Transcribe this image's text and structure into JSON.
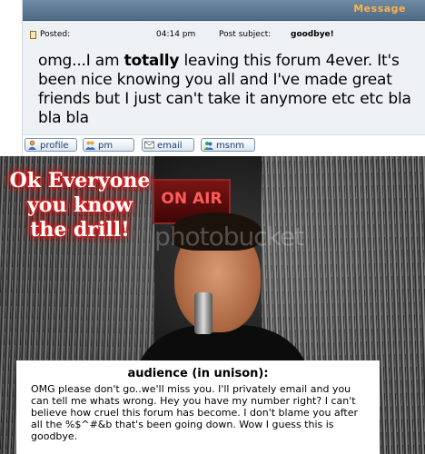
{
  "header": {
    "title": "Message"
  },
  "post": {
    "posted_label": "Posted:",
    "time": "04:14 pm",
    "subject_label": "Post subject:",
    "subject": "goodbye!",
    "body_before": "omg...I am ",
    "body_bold": "totally",
    "body_after": " leaving this forum 4ever. It's been nice knowing you all and I've made great friends but I just can't take it anymore etc etc bla bla bla"
  },
  "buttons": {
    "profile": "profile",
    "pm": "pm",
    "email": "email",
    "msnm": "msnm"
  },
  "image": {
    "on_air": "ON AIR",
    "overlay": "Ok Everyone you know the drill!",
    "watermark": "photobucket",
    "audience_title": "audience (in unison):",
    "audience_text": "OMG please don't go..we'll miss you. I'll privately email and you can tell me whats wrong. Hey you have my number right? I can't believe how cruel this forum has become. I don't blame you after all the %$^#&b that's been going down. Wow I guess this is goodbye."
  },
  "colors": {
    "header_bg": "#5d7893",
    "header_text": "#ffb24a",
    "panel_bg": "#eef1f4",
    "glow": "#ff0000"
  }
}
